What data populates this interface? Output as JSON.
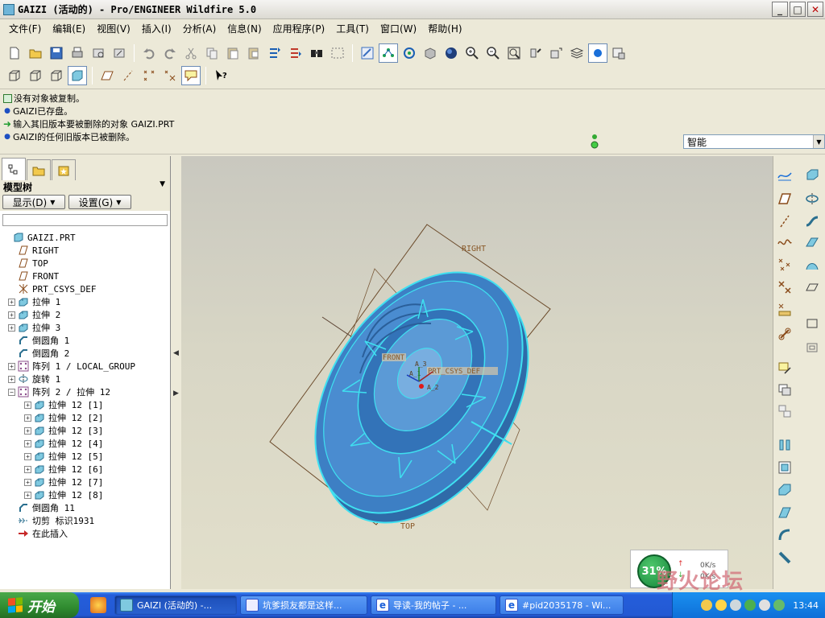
{
  "window": {
    "title": "GAIZI (活动的) - Pro/ENGINEER Wildfire 5.0"
  },
  "menubar": {
    "items": [
      "文件(F)",
      "编辑(E)",
      "视图(V)",
      "插入(I)",
      "分析(A)",
      "信息(N)",
      "应用程序(P)",
      "工具(T)",
      "窗口(W)",
      "帮助(H)"
    ]
  },
  "messages": [
    {
      "icon": "status-icon",
      "text": "没有对象被复制。"
    },
    {
      "icon": "bullet",
      "text": "GAIZI已存盘。"
    },
    {
      "icon": "green-arrow-icon",
      "text": "输入其旧版本要被删除的对象    GAIZI.PRT"
    },
    {
      "icon": "bullet",
      "text": "GAIZI的任何旧版本已被删除。"
    }
  ],
  "filter": {
    "value": "智能"
  },
  "model_tree": {
    "header": "模型树",
    "show_button": "显示(D)",
    "settings_button": "设置(G)",
    "items": [
      {
        "label": "GAIZI.PRT",
        "icon": "part-icon",
        "indent": 0,
        "expander": "none"
      },
      {
        "label": "RIGHT",
        "icon": "datum-plane-icon",
        "indent": 1,
        "expander": "none"
      },
      {
        "label": "TOP",
        "icon": "datum-plane-icon",
        "indent": 1,
        "expander": "none"
      },
      {
        "label": "FRONT",
        "icon": "datum-plane-icon",
        "indent": 1,
        "expander": "none"
      },
      {
        "label": "PRT_CSYS_DEF",
        "icon": "csys-icon",
        "indent": 1,
        "expander": "none"
      },
      {
        "label": "拉伸 1",
        "icon": "extrude-icon",
        "indent": 1,
        "expander": "plus"
      },
      {
        "label": "拉伸 2",
        "icon": "extrude-icon",
        "indent": 1,
        "expander": "plus"
      },
      {
        "label": "拉伸 3",
        "icon": "extrude-icon",
        "indent": 1,
        "expander": "plus"
      },
      {
        "label": "倒圆角 1",
        "icon": "round-icon",
        "indent": 1,
        "expander": "none"
      },
      {
        "label": "倒圆角 2",
        "icon": "round-icon",
        "indent": 1,
        "expander": "none"
      },
      {
        "label": "阵列 1 / LOCAL_GROUP",
        "icon": "pattern-icon",
        "indent": 1,
        "expander": "plus"
      },
      {
        "label": "旋转 1",
        "icon": "revolve-icon",
        "indent": 1,
        "expander": "plus"
      },
      {
        "label": "阵列 2 / 拉伸 12",
        "icon": "pattern-icon",
        "indent": 1,
        "expander": "minus"
      },
      {
        "label": "拉伸 12 [1]",
        "icon": "extrude-icon",
        "indent": 2,
        "expander": "plus"
      },
      {
        "label": "拉伸 12 [2]",
        "icon": "extrude-icon",
        "indent": 2,
        "expander": "plus"
      },
      {
        "label": "拉伸 12 [3]",
        "icon": "extrude-icon",
        "indent": 2,
        "expander": "plus"
      },
      {
        "label": "拉伸 12 [4]",
        "icon": "extrude-icon",
        "indent": 2,
        "expander": "plus"
      },
      {
        "label": "拉伸 12 [5]",
        "icon": "extrude-icon",
        "indent": 2,
        "expander": "plus"
      },
      {
        "label": "拉伸 12 [6]",
        "icon": "extrude-icon",
        "indent": 2,
        "expander": "plus"
      },
      {
        "label": "拉伸 12 [7]",
        "icon": "extrude-icon",
        "indent": 2,
        "expander": "plus"
      },
      {
        "label": "拉伸 12 [8]",
        "icon": "extrude-icon",
        "indent": 2,
        "expander": "plus"
      },
      {
        "label": "倒圆角 11",
        "icon": "round-icon",
        "indent": 1,
        "expander": "none"
      },
      {
        "label": "切剪 标识1931",
        "icon": "cut-icon",
        "indent": 1,
        "expander": "none"
      },
      {
        "label": "在此插入",
        "icon": "insert-here-icon",
        "indent": 1,
        "expander": "none"
      }
    ]
  },
  "viewport": {
    "datum_labels": {
      "right": "RIGHT",
      "top": "TOP",
      "front": "FRONT",
      "csys": "PRT_CSYS_DEF",
      "axis_a3": "A_3",
      "axis_a1": "A_1",
      "axis_a2": "A_2"
    },
    "model_color": "#3d7fc4",
    "highlight_color": "#3fe0f0"
  },
  "network": {
    "percent": "31%",
    "up": "0K/s",
    "down": "0K/s"
  },
  "watermark": "野火论坛",
  "taskbar": {
    "start": "开始",
    "items": [
      {
        "label": "GAIZI (活动的) -...",
        "active": true
      },
      {
        "label": "坑爹损友都是这样...",
        "active": false
      },
      {
        "label": "导读-我的帖子 - ...",
        "active": false
      },
      {
        "label": "#pid2035178 - Wi...",
        "active": false
      }
    ],
    "clock": "13:44"
  }
}
